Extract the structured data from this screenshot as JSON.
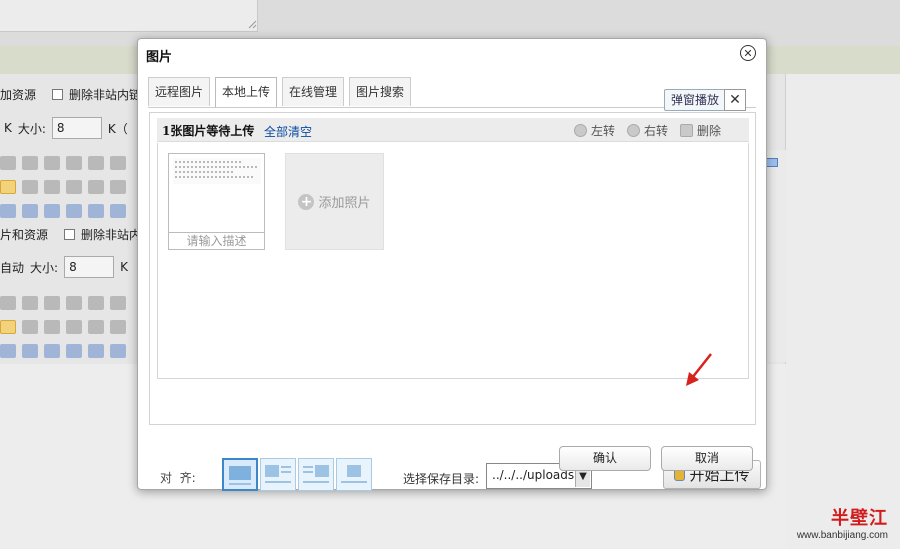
{
  "background": {
    "row1": {
      "resource_text": "加资源",
      "remove_links_text": "删除非站内链接"
    },
    "row2": {
      "k_label": "K",
      "size_label": "大小:",
      "size_value": "8",
      "k_unit": "K（"
    },
    "row3": {
      "resource_text": "片和资源",
      "remove_links_text": "删除非站内链接"
    },
    "row4": {
      "auto_label": "自动",
      "size_label": "大小:",
      "size_value": "8",
      "k_unit": "K"
    }
  },
  "dialog": {
    "title": "图片",
    "tabs": [
      {
        "label": "远程图片"
      },
      {
        "label": "本地上传"
      },
      {
        "label": "在线管理"
      },
      {
        "label": "图片搜索"
      }
    ],
    "popup_label": "弹窗播放",
    "queue_text": "1张图片等待上传",
    "clear_all": "全部清空",
    "rotate_left": "左转",
    "rotate_right": "右转",
    "delete": "删除",
    "thumb_desc_placeholder": "请输入描述",
    "add_photo": "添加照片",
    "align_label": "对  齐:",
    "save_dir_label": "选择保存目录:",
    "save_dir_value": "../../../uploads",
    "start_upload": "开始上传",
    "ok": "确认",
    "cancel": "取消"
  },
  "watermark": {
    "logo": "半壁江",
    "url": "www.banbijiang.com"
  },
  "colors": {
    "link": "#0b4ba3",
    "active_align": "#3d87c9",
    "arrow": "#d8221c"
  }
}
